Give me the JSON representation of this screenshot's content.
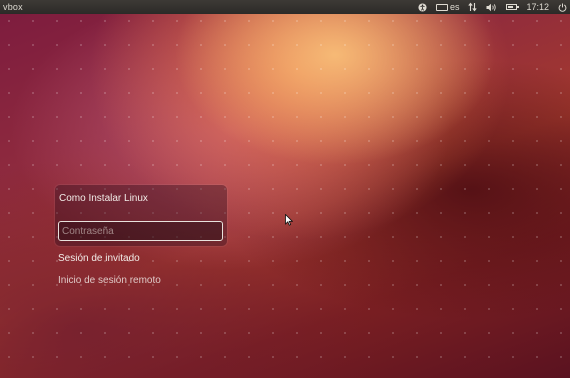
{
  "top_panel": {
    "hostname": "vbox",
    "keyboard_layout": "es",
    "time": "17:12",
    "battery_level": 0.7,
    "icons": [
      "accessibility-icon",
      "keyboard-icon",
      "network-icon",
      "volume-icon",
      "battery-icon",
      "power-icon"
    ]
  },
  "login": {
    "user_name": "Como Instalar Linux",
    "password_placeholder": "Contraseña",
    "password_value": ""
  },
  "options": {
    "guest_session": "Sesión de invitado",
    "remote_login": "Inicio de sesión remoto"
  },
  "colors": {
    "panel": "#2c2a28",
    "panel_text": "#dfdbd2",
    "text": "#f2ece8"
  }
}
